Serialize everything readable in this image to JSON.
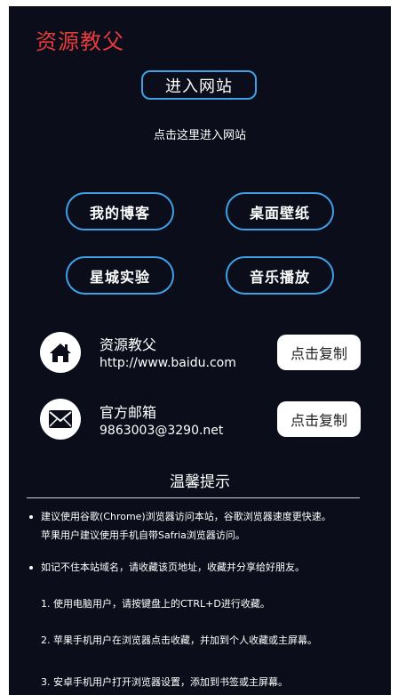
{
  "brand": "资源教父",
  "enter": {
    "button_label": "进入网站",
    "hint": "点击这里进入网站"
  },
  "nav": [
    {
      "label": "我的博客"
    },
    {
      "label": "桌面壁纸"
    },
    {
      "label": "星城实验"
    },
    {
      "label": "音乐播放"
    }
  ],
  "contacts": [
    {
      "icon": "home-icon",
      "title": "资源教父",
      "value": "http://www.baidu.com",
      "copy_label": "点击复制"
    },
    {
      "icon": "mail-icon",
      "title": "官方邮箱",
      "value": "9863003@3290.net",
      "copy_label": "点击复制"
    }
  ],
  "tips": {
    "title": "温馨提示",
    "bullets": [
      {
        "line1": "建议使用谷歌(Chrome)浏览器访问本站，谷歌浏览器速度更快速。",
        "line2": "苹果用户建议使用手机自带Safria浏览器访问。"
      },
      {
        "line1": "如记不住本站域名，请收藏该页地址，收藏并分享给好朋友。"
      }
    ],
    "steps": [
      "1. 使用电脑用户，请按键盘上的CTRL+D进行收藏。",
      "2. 苹果手机用户在浏览器点击收藏，并加到个人收藏或主屏幕。",
      "3. 安卓手机用户打开浏览器设置，添加到书签或主屏幕。"
    ]
  },
  "colors": {
    "background": "#0b0e1a",
    "accent_border": "#3fa0e6",
    "brand": "#e53b3b"
  }
}
